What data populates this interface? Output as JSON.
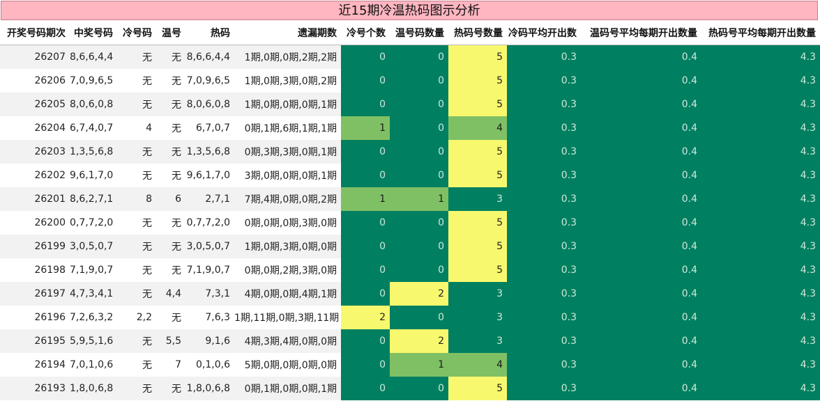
{
  "title": "近15期冷温热码图示分析",
  "columns": [
    "开奖号码期次",
    "中奖号码",
    "冷号码",
    "温号",
    "热码",
    "遗漏期数",
    "冷号个数",
    "温号码数量",
    "热码号数量",
    "冷码平均开出数",
    "温码号平均每期开出数量",
    "热码号平均每期开出数量"
  ],
  "colors": {
    "dark_green": "#008060",
    "yellow": "#f8f86e",
    "light_green": "#80c064",
    "title_bg": "#ffb6c1"
  },
  "rows": [
    {
      "issue": "26207",
      "winning": "8,6,6,4,4",
      "cold": "无",
      "warm": "无",
      "hot": "8,6,6,4,4",
      "omission": "1期,0期,0期,2期,2期",
      "cold_count": "0",
      "warm_count": "0",
      "hot_count": "5",
      "cold_avg": "0.3",
      "warm_avg": "0.4",
      "hot_avg": "4.3"
    },
    {
      "issue": "26206",
      "winning": "7,0,9,6,5",
      "cold": "无",
      "warm": "无",
      "hot": "7,0,9,6,5",
      "omission": "1期,0期,3期,0期,2期",
      "cold_count": "0",
      "warm_count": "0",
      "hot_count": "5",
      "cold_avg": "0.3",
      "warm_avg": "0.4",
      "hot_avg": "4.3"
    },
    {
      "issue": "26205",
      "winning": "8,0,6,0,8",
      "cold": "无",
      "warm": "无",
      "hot": "8,0,6,0,8",
      "omission": "1期,0期,0期,0期,1期",
      "cold_count": "0",
      "warm_count": "0",
      "hot_count": "5",
      "cold_avg": "0.3",
      "warm_avg": "0.4",
      "hot_avg": "4.3"
    },
    {
      "issue": "26204",
      "winning": "6,7,4,0,7",
      "cold": "4",
      "warm": "无",
      "hot": "6,7,0,7",
      "omission": "0期,1期,6期,1期,1期",
      "cold_count": "1",
      "warm_count": "0",
      "hot_count": "4",
      "cold_avg": "0.3",
      "warm_avg": "0.4",
      "hot_avg": "4.3"
    },
    {
      "issue": "26203",
      "winning": "1,3,5,6,8",
      "cold": "无",
      "warm": "无",
      "hot": "1,3,5,6,8",
      "omission": "0期,3期,3期,0期,1期",
      "cold_count": "0",
      "warm_count": "0",
      "hot_count": "5",
      "cold_avg": "0.3",
      "warm_avg": "0.4",
      "hot_avg": "4.3"
    },
    {
      "issue": "26202",
      "winning": "9,6,1,7,0",
      "cold": "无",
      "warm": "无",
      "hot": "9,6,1,7,0",
      "omission": "3期,0期,0期,0期,1期",
      "cold_count": "0",
      "warm_count": "0",
      "hot_count": "5",
      "cold_avg": "0.3",
      "warm_avg": "0.4",
      "hot_avg": "4.3"
    },
    {
      "issue": "26201",
      "winning": "8,6,2,7,1",
      "cold": "8",
      "warm": "6",
      "hot": "2,7,1",
      "omission": "7期,4期,0期,0期,2期",
      "cold_count": "1",
      "warm_count": "1",
      "hot_count": "3",
      "cold_avg": "0.3",
      "warm_avg": "0.4",
      "hot_avg": "4.3"
    },
    {
      "issue": "26200",
      "winning": "0,7,7,2,0",
      "cold": "无",
      "warm": "无",
      "hot": "0,7,7,2,0",
      "omission": "0期,0期,0期,3期,0期",
      "cold_count": "0",
      "warm_count": "0",
      "hot_count": "5",
      "cold_avg": "0.3",
      "warm_avg": "0.4",
      "hot_avg": "4.3"
    },
    {
      "issue": "26199",
      "winning": "3,0,5,0,7",
      "cold": "无",
      "warm": "无",
      "hot": "3,0,5,0,7",
      "omission": "1期,0期,3期,0期,0期",
      "cold_count": "0",
      "warm_count": "0",
      "hot_count": "5",
      "cold_avg": "0.3",
      "warm_avg": "0.4",
      "hot_avg": "4.3"
    },
    {
      "issue": "26198",
      "winning": "7,1,9,0,7",
      "cold": "无",
      "warm": "无",
      "hot": "7,1,9,0,7",
      "omission": "0期,0期,2期,3期,0期",
      "cold_count": "0",
      "warm_count": "0",
      "hot_count": "5",
      "cold_avg": "0.3",
      "warm_avg": "0.4",
      "hot_avg": "4.3"
    },
    {
      "issue": "26197",
      "winning": "4,7,3,4,1",
      "cold": "无",
      "warm": "4,4",
      "hot": "7,3,1",
      "omission": "4期,0期,0期,4期,1期",
      "cold_count": "0",
      "warm_count": "2",
      "hot_count": "3",
      "cold_avg": "0.3",
      "warm_avg": "0.4",
      "hot_avg": "4.3"
    },
    {
      "issue": "26196",
      "winning": "7,2,6,3,2",
      "cold": "2,2",
      "warm": "无",
      "hot": "7,6,3",
      "omission": "1期,11期,0期,3期,11期",
      "cold_count": "2",
      "warm_count": "0",
      "hot_count": "3",
      "cold_avg": "0.3",
      "warm_avg": "0.4",
      "hot_avg": "4.3"
    },
    {
      "issue": "26195",
      "winning": "5,9,5,1,6",
      "cold": "无",
      "warm": "5,5",
      "hot": "9,1,6",
      "omission": "4期,3期,4期,0期,0期",
      "cold_count": "0",
      "warm_count": "2",
      "hot_count": "3",
      "cold_avg": "0.3",
      "warm_avg": "0.4",
      "hot_avg": "4.3"
    },
    {
      "issue": "26194",
      "winning": "7,0,1,0,6",
      "cold": "无",
      "warm": "7",
      "hot": "0,1,0,6",
      "omission": "5期,0期,0期,0期,0期",
      "cold_count": "0",
      "warm_count": "1",
      "hot_count": "4",
      "cold_avg": "0.3",
      "warm_avg": "0.4",
      "hot_avg": "4.3"
    },
    {
      "issue": "26193",
      "winning": "1,8,0,6,8",
      "cold": "无",
      "warm": "无",
      "hot": "1,8,0,6,8",
      "omission": "0期,1期,0期,0期,1期",
      "cold_count": "0",
      "warm_count": "0",
      "hot_count": "5",
      "cold_avg": "0.3",
      "warm_avg": "0.4",
      "hot_avg": "4.3"
    }
  ]
}
